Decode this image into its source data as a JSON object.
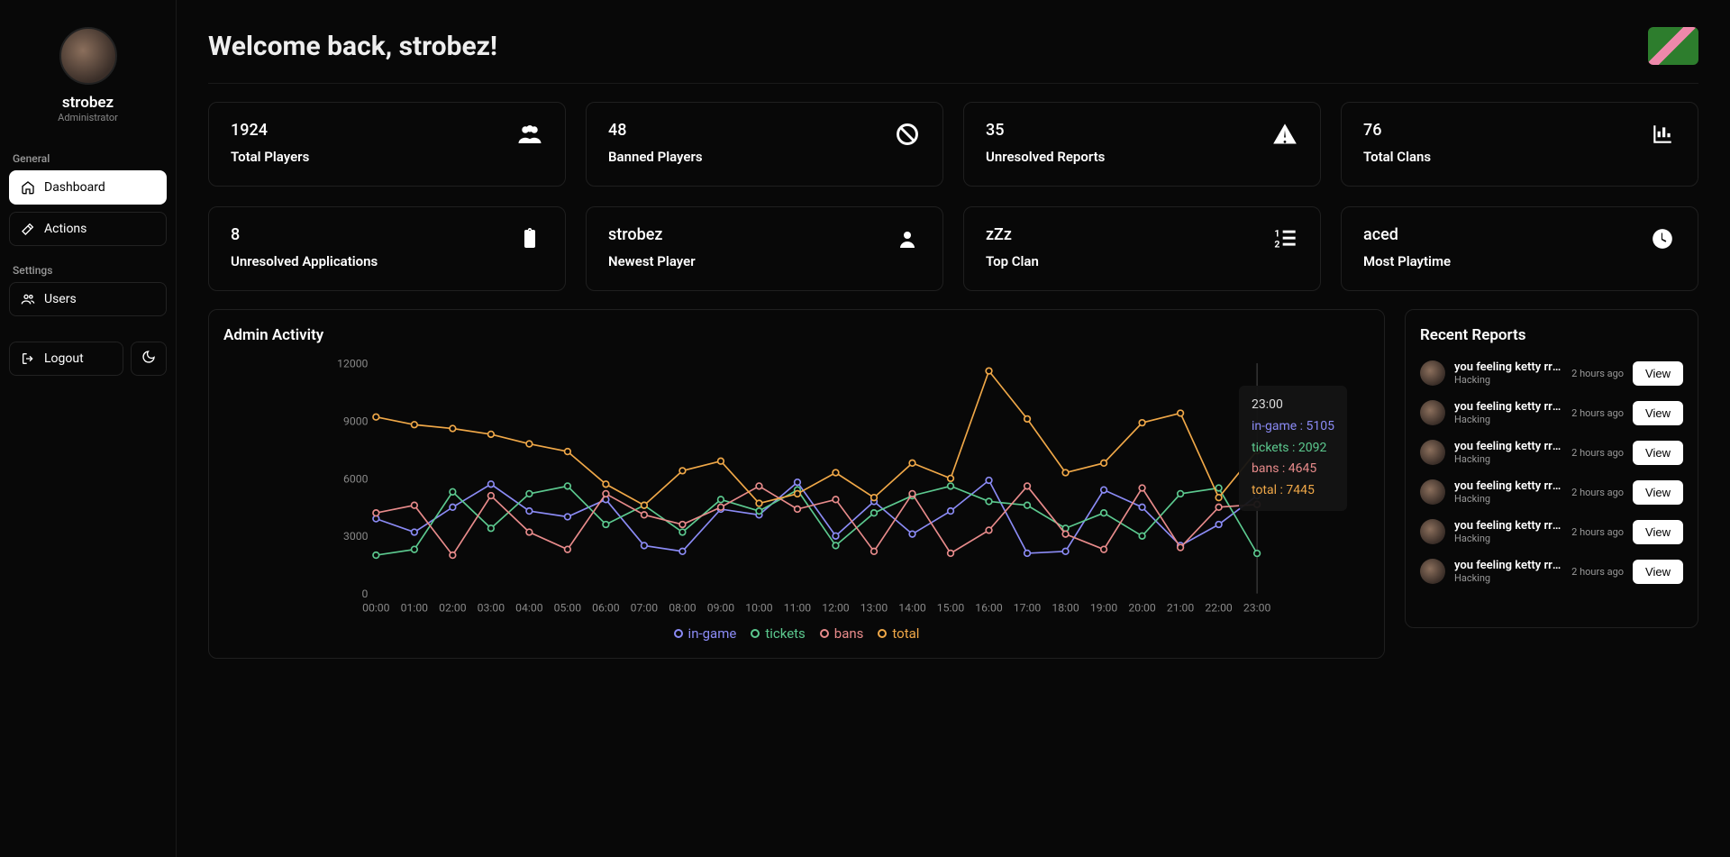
{
  "user": {
    "name": "strobez",
    "role": "Administrator"
  },
  "sidebar": {
    "sections": {
      "general": {
        "label": "General",
        "items": [
          {
            "label": "Dashboard",
            "active": true
          },
          {
            "label": "Actions",
            "active": false
          }
        ]
      },
      "settings": {
        "label": "Settings",
        "items": [
          {
            "label": "Users",
            "active": false
          }
        ]
      }
    },
    "logout": "Logout"
  },
  "header": {
    "welcome": "Welcome back, strobez!"
  },
  "stats": [
    {
      "value": "1924",
      "label": "Total Players",
      "icon": "users"
    },
    {
      "value": "48",
      "label": "Banned Players",
      "icon": "ban"
    },
    {
      "value": "35",
      "label": "Unresolved Reports",
      "icon": "warning"
    },
    {
      "value": "76",
      "label": "Total Clans",
      "icon": "chart"
    },
    {
      "value": "8",
      "label": "Unresolved Applications",
      "icon": "clipboard"
    },
    {
      "value": "strobez",
      "label": "Newest Player",
      "icon": "user"
    },
    {
      "value": "zZz",
      "label": "Top Clan",
      "icon": "list"
    },
    {
      "value": "aced",
      "label": "Most Playtime",
      "icon": "clock"
    }
  ],
  "chart_panel": {
    "title": "Admin Activity"
  },
  "chart_data": {
    "type": "line",
    "title": "Admin Activity",
    "xlabel": "",
    "ylabel": "",
    "ylim": [
      0,
      12000
    ],
    "yticks": [
      0,
      3000,
      6000,
      9000,
      12000
    ],
    "categories": [
      "00:00",
      "01:00",
      "02:00",
      "03:00",
      "04:00",
      "05:00",
      "06:00",
      "07:00",
      "08:00",
      "09:00",
      "10:00",
      "11:00",
      "12:00",
      "13:00",
      "14:00",
      "15:00",
      "16:00",
      "17:00",
      "18:00",
      "19:00",
      "20:00",
      "21:00",
      "22:00",
      "23:00"
    ],
    "series": [
      {
        "name": "in-game",
        "color": "#8b8bf5",
        "values": [
          3900,
          3200,
          4500,
          5700,
          4300,
          4000,
          4900,
          2500,
          2200,
          4400,
          4100,
          5800,
          3000,
          4800,
          3100,
          4300,
          5900,
          2100,
          2200,
          5400,
          4500,
          2500,
          3600,
          5105
        ]
      },
      {
        "name": "tickets",
        "color": "#5cc98f",
        "values": [
          2000,
          2300,
          5300,
          3400,
          5200,
          5600,
          3600,
          4600,
          3200,
          4900,
          4300,
          5400,
          2500,
          4200,
          5100,
          5600,
          4800,
          4600,
          3400,
          4200,
          3000,
          5200,
          5500,
          2092
        ]
      },
      {
        "name": "bans",
        "color": "#e88b8b",
        "values": [
          4200,
          4600,
          2000,
          5100,
          3200,
          2300,
          5200,
          4100,
          3600,
          4500,
          5600,
          4400,
          4900,
          2200,
          5200,
          2100,
          3300,
          5600,
          3100,
          2300,
          5500,
          2400,
          4500,
          4645
        ]
      },
      {
        "name": "total",
        "color": "#f0a848",
        "values": [
          9200,
          8800,
          8600,
          8300,
          7800,
          7400,
          5700,
          4600,
          6400,
          6900,
          4700,
          5200,
          6300,
          5000,
          6800,
          6000,
          11600,
          9100,
          6300,
          6800,
          8900,
          9400,
          5000,
          7445
        ]
      }
    ],
    "legend_position": "bottom",
    "tooltip": {
      "time": "23:00",
      "rows": [
        {
          "label": "in-game",
          "value": 5105,
          "color": "#8b8bf5"
        },
        {
          "label": "tickets",
          "value": 2092,
          "color": "#5cc98f"
        },
        {
          "label": "bans",
          "value": 4645,
          "color": "#e88b8b"
        },
        {
          "label": "total",
          "value": 7445,
          "color": "#f0a848"
        }
      ]
    }
  },
  "reports": {
    "title": "Recent Reports",
    "items": [
      {
        "title": "you feeling ketty rrr...",
        "category": "Hacking",
        "time": "2 hours ago",
        "action": "View"
      },
      {
        "title": "you feeling ketty rrr...",
        "category": "Hacking",
        "time": "2 hours ago",
        "action": "View"
      },
      {
        "title": "you feeling ketty rrr...",
        "category": "Hacking",
        "time": "2 hours ago",
        "action": "View"
      },
      {
        "title": "you feeling ketty rrr...",
        "category": "Hacking",
        "time": "2 hours ago",
        "action": "View"
      },
      {
        "title": "you feeling ketty rrr...",
        "category": "Hacking",
        "time": "2 hours ago",
        "action": "View"
      },
      {
        "title": "you feeling ketty rrr...",
        "category": "Hacking",
        "time": "2 hours ago",
        "action": "View"
      }
    ]
  }
}
